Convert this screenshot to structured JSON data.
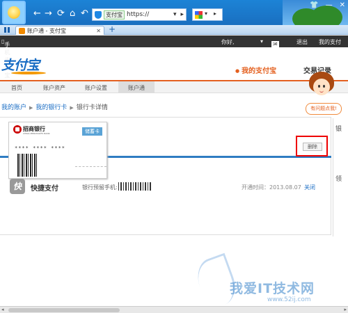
{
  "browser": {
    "secure_tag": "支付宝",
    "url": "https://",
    "tab_title": "账户通 - 支付宝",
    "nav_icons": [
      "back-icon",
      "forward-icon",
      "refresh-icon",
      "undo-icon"
    ]
  },
  "topnav": {
    "mobile": "手机支付宝",
    "greeting": "你好,",
    "messages": "2",
    "logout": "退出",
    "my_alipay": "我的支付"
  },
  "header": {
    "logo": "支付宝",
    "nav_active": "我的支付宝",
    "nav_trade": "交易记录"
  },
  "subnav": [
    "首页",
    "账户资产",
    "账户设置",
    "账户通"
  ],
  "breadcrumb": [
    "我的账户",
    "我的银行卡",
    "银行卡详情"
  ],
  "card": {
    "bank_name": "招商银行",
    "bank_en": "CHINA MERCHANTS BANK",
    "type": "储蓄卡",
    "number": "**** **** ****"
  },
  "delete_label": "删除",
  "quickpay": {
    "icon": "快",
    "title": "快捷支付",
    "phone_label": "银行预留手机:",
    "open_time": "开通时间：2013.08.07",
    "close": "关闭"
  },
  "helper": {
    "bubble": "有问题点我!"
  },
  "side_chars": [
    "银",
    "领"
  ],
  "watermark": {
    "title": "我爱IT技术网",
    "url": "www.52ij.com"
  },
  "colors": {
    "brand_orange": "#e4601f",
    "brand_blue": "#1a6dc4",
    "highlight_red": "#ee0000"
  }
}
